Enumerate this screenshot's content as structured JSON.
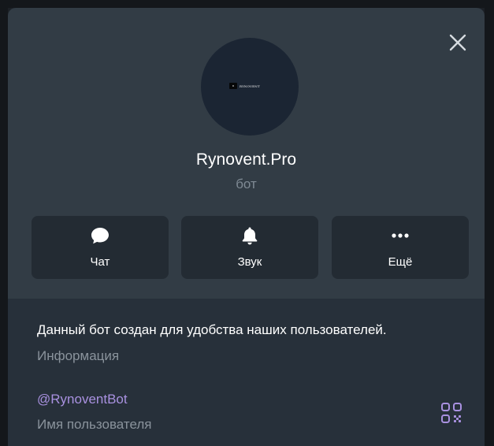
{
  "profile": {
    "avatar_text": "RYNOVENT",
    "avatar_mark": "R",
    "name": "Rynovent.Pro",
    "type": "бот"
  },
  "actions": [
    {
      "label": "Чат",
      "icon": "chat-bubble-icon"
    },
    {
      "label": "Звук",
      "icon": "bell-icon"
    },
    {
      "label": "Ещё",
      "icon": "more-dots-icon"
    }
  ],
  "info": {
    "description": "Данный бот создан для удобства наших пользователей.",
    "description_caption": "Информация",
    "username": "@RynoventBot",
    "username_caption": "Имя пользователя"
  },
  "colors": {
    "panel": "#323c45",
    "button": "#232b33",
    "info_section": "#27303a",
    "link": "#a991e0",
    "muted": "#8a939c"
  }
}
